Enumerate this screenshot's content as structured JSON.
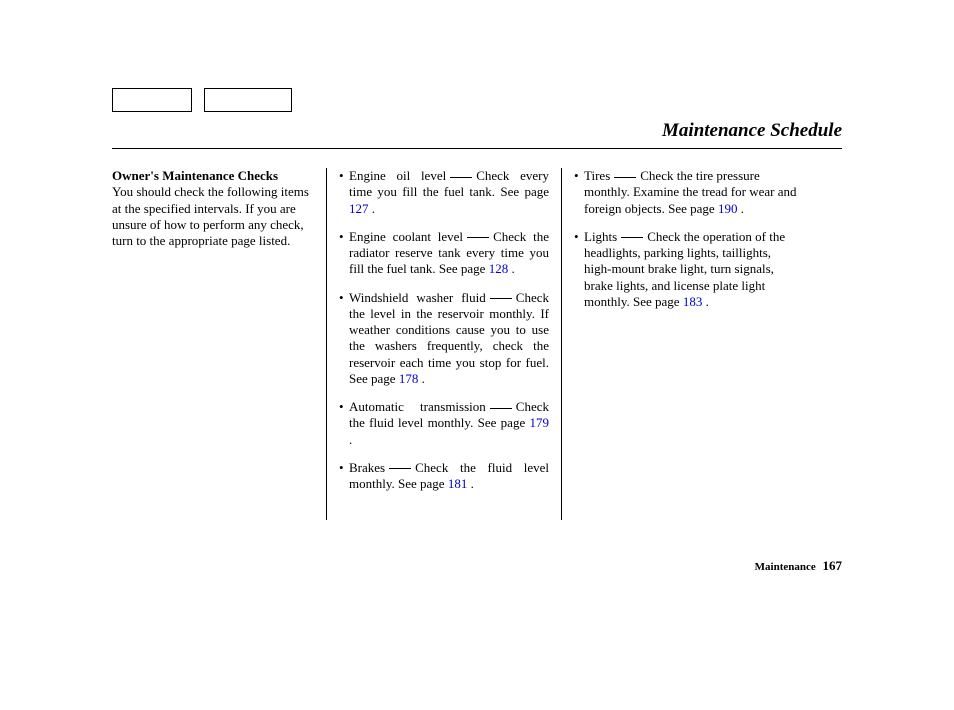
{
  "title": "Maintenance Schedule",
  "col1": {
    "heading": "Owner's Maintenance Checks",
    "intro": "You should check the following items at the specified intervals. If you are unsure of how to perform any check, turn to the appropriate page listed."
  },
  "col2": {
    "items": [
      {
        "label": "Engine oil level",
        "text_before": "Check every time you fill the fuel tank. See page ",
        "page_ref": "127",
        "text_after": " ."
      },
      {
        "label": "Engine coolant level",
        "text_before": "Check the radiator reserve tank every time you fill the fuel tank. See page ",
        "page_ref": "128",
        "text_after": " ."
      },
      {
        "label": "Windshield washer fluid",
        "text_before": "Check the level in the reservoir monthly. If weather conditions cause you to use the washers frequently, check the reservoir each time you stop for fuel. See page ",
        "page_ref": "178",
        "text_after": " ."
      },
      {
        "label": "Automatic transmission",
        "text_before": "Check the fluid level monthly. See page ",
        "page_ref": "179",
        "text_after": "  ."
      },
      {
        "label": "Brakes",
        "text_before": "Check the fluid level monthly. See page ",
        "page_ref": "181",
        "text_after": "  ."
      }
    ]
  },
  "col3": {
    "items": [
      {
        "label": "Tires",
        "text_before": "Check the tire pressure monthly. Examine the tread for wear and foreign objects. See page ",
        "page_ref": "190",
        "text_after": " ."
      },
      {
        "label": "Lights",
        "text_before": "Check the operation of the headlights, parking lights, taillights, high-mount brake light, turn signals, brake lights, and license plate light monthly. See page ",
        "page_ref": "183",
        "text_after": " ."
      }
    ]
  },
  "footer": {
    "section": "Maintenance",
    "page_number": "167"
  }
}
